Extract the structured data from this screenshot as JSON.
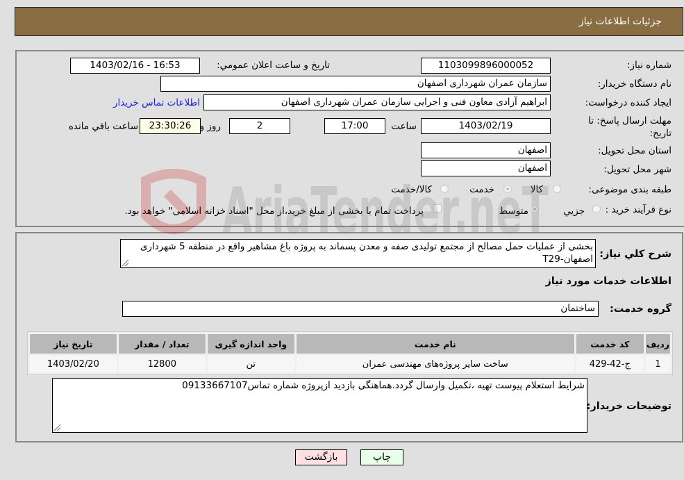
{
  "header": {
    "title": "جزئیات اطلاعات نیاز"
  },
  "form": {
    "need_number": {
      "label": "شماره نیاز:",
      "value": "1103099896000052"
    },
    "announce_datetime": {
      "label": "تاریخ و ساعت اعلان عمومي:",
      "value": "1403/02/16 - 16:53"
    },
    "buyer_org": {
      "label": "نام دستگاه خریدار:",
      "value": "سازمان عمران شهرداری اصفهان"
    },
    "creator": {
      "label": "ایجاد کننده درخواست:",
      "value": "ابراهیم آزادی معاون فنی و اجرایی سازمان عمران شهرداری اصفهان",
      "contact_link": "اطلاعات تماس خریدار"
    },
    "deadline": {
      "label": "مهلت ارسال پاسخ: تا تاریخ:",
      "date": "1403/02/19",
      "time_label": "ساعت",
      "time": "17:00",
      "days": "2",
      "days_label": "روز و",
      "remaining": "23:30:26",
      "remaining_label": "ساعت باقي مانده"
    },
    "province": {
      "label": "استان محل تحویل:",
      "value": "اصفهان"
    },
    "city": {
      "label": "شهر محل تحویل:",
      "value": "اصفهان"
    },
    "category": {
      "label": "طبقه بندی موضوعی:",
      "options": [
        "کالا",
        "خدمت",
        "کالا/خدمت"
      ],
      "selected": "خدمت"
    },
    "purchase_type": {
      "label": "نوع فرآیند خرید :",
      "options": [
        "جزيي",
        "متوسط"
      ],
      "selected": "متوسط",
      "treasury_note": "پرداخت تمام یا بخشی از مبلغ خرید،از محل \"اسناد خزانه اسلامی\" خواهد بود."
    }
  },
  "details": {
    "description_label": "شرح کلي نیاز:",
    "description": "بخشی از عملیات حمل مصالح از مجتمع تولیدی صفه و معدن پسماند به پروژه باغ مشاهیر واقع در منطقه 5 شهرداری اصفهان-T29",
    "services_heading": "اطلاعات خدمات مورد نیاز",
    "service_group_label": "گروه خدمت:",
    "service_group": "ساختمان",
    "table": {
      "headers": [
        "ردیف",
        "کد خدمت",
        "نام خدمت",
        "واحد اندازه گیری",
        "تعداد / مقدار",
        "تاریخ نیاز"
      ],
      "rows": [
        [
          "1",
          "ج-42-429",
          "ساخت سایر پروژه‌های مهندسی عمران",
          "تن",
          "12800",
          "1403/02/20"
        ]
      ]
    },
    "buyer_notes_label": "توضیحات خریدار:",
    "buyer_notes": "شرایط استعلام پیوست تهیه ،تکمیل وارسال گردد.هماهنگی بازدید ازپروژه شماره تماس09133667107"
  },
  "buttons": {
    "print": "چاپ",
    "back": "بازگشت"
  },
  "colors": {
    "header_bg": "#8b6d43",
    "back_button_bg": "#ffe0e0",
    "print_button_bg": "#e8ffe8",
    "link": "#2020e0"
  },
  "watermark": "AriaTender.neT"
}
